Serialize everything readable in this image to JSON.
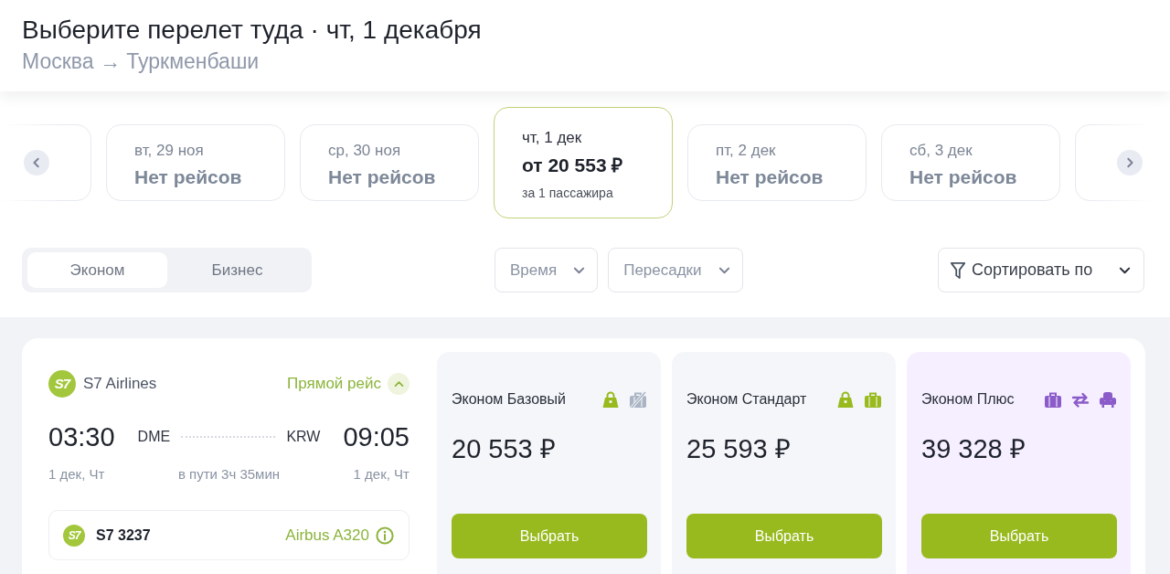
{
  "header": {
    "title": "Выберите перелет туда · чт, 1 декабря",
    "route": "Москва → Туркменбаши"
  },
  "dates": [
    {
      "date": "вт, 29 ноя",
      "price": "Нет рейсов",
      "selected": false
    },
    {
      "date": "ср, 30 ноя",
      "price": "Нет рейсов",
      "selected": false
    },
    {
      "date": "чт, 1 дек",
      "price": "от 20 553 ₽",
      "note": "за 1 пассажира",
      "selected": true
    },
    {
      "date": "пт, 2 дек",
      "price": "Нет рейсов",
      "selected": false
    },
    {
      "date": "сб, 3 дек",
      "price": "Нет рейсов",
      "selected": false
    }
  ],
  "cabin_tabs": [
    {
      "label": "Эконом",
      "selected": true
    },
    {
      "label": "Бизнес",
      "selected": false
    }
  ],
  "filters": [
    {
      "label": "Время"
    },
    {
      "label": "Пересадки"
    }
  ],
  "sort": {
    "label": "Сортировать по"
  },
  "flight": {
    "airline": {
      "logo": "S7",
      "name": "S7 Airlines"
    },
    "direct_label": "Прямой рейс",
    "expanded": true,
    "departure": {
      "time": "03:30",
      "airport": "DME",
      "date": "1 дек, Чт"
    },
    "duration": "в пути 3ч 35мин",
    "arrival": {
      "time": "09:05",
      "airport": "KRW",
      "date": "1 дек, Чт"
    },
    "segment": {
      "logo": "S7",
      "number": "S7 3237",
      "aircraft": "Airbus A320"
    }
  },
  "fares": [
    {
      "name": "Эконом Базовый",
      "featured": false,
      "features": [
        {
          "kind": "hand-luggage",
          "included": true
        },
        {
          "kind": "baggage",
          "included": false
        }
      ],
      "price": "20 553 ₽",
      "button": "Выбрать"
    },
    {
      "name": "Эконом Стандарт",
      "featured": false,
      "features": [
        {
          "kind": "hand-luggage",
          "included": true
        },
        {
          "kind": "baggage",
          "included": true
        }
      ],
      "price": "25 593 ₽",
      "button": "Выбрать"
    },
    {
      "name": "Эконом Плюс",
      "featured": true,
      "features": [
        {
          "kind": "baggage",
          "included": true
        },
        {
          "kind": "exchange",
          "included": true
        },
        {
          "kind": "seat",
          "included": true
        }
      ],
      "price": "39 328 ₽",
      "button": "Выбрать"
    }
  ]
}
